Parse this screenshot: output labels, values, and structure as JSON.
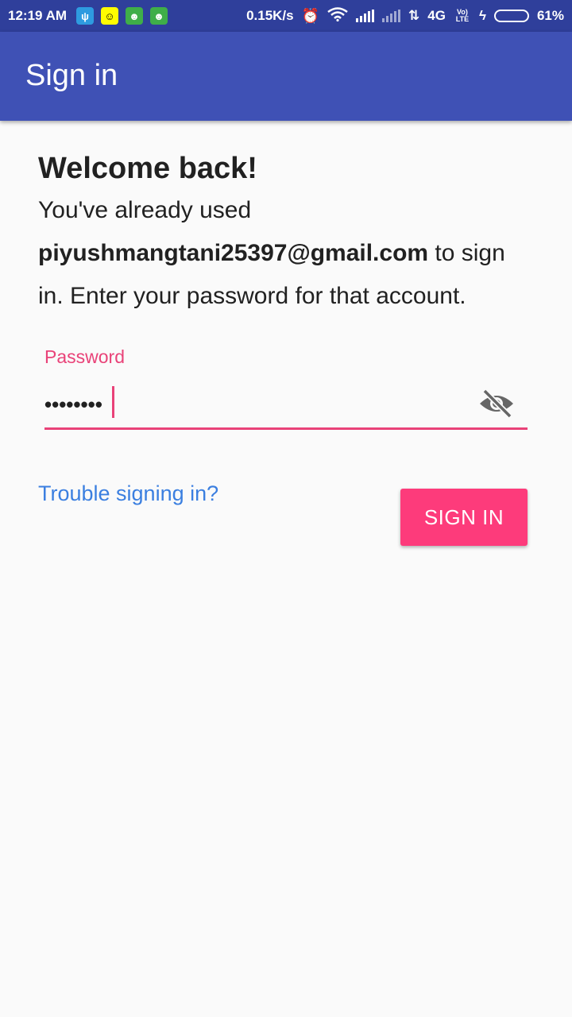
{
  "status_bar": {
    "time": "12:19 AM",
    "net_speed": "0.15K/s",
    "network_type": "4G",
    "volte": "Vo) LTE",
    "battery_percent": "61%",
    "battery_level": 0.61,
    "notification_icons": [
      "usb-icon",
      "snapchat-icon",
      "android-icon",
      "android-icon"
    ]
  },
  "app_bar": {
    "title": "Sign in"
  },
  "main": {
    "heading": "Welcome back!",
    "message_prefix": "You've already used ",
    "email": "piyushmangtani25397@gmail.com",
    "message_suffix": " to sign in. Enter your password for that account."
  },
  "password": {
    "label": "Password",
    "value": "••••••••",
    "toggle_icon": "visibility-off-icon"
  },
  "actions": {
    "trouble_link": "Trouble signing in?",
    "sign_in_button": "SIGN IN"
  },
  "colors": {
    "status_bar": "#2f3f9b",
    "app_bar": "#3f51b5",
    "accent": "#e94278",
    "button": "#fd3b7b",
    "link": "#3b7fe0"
  }
}
